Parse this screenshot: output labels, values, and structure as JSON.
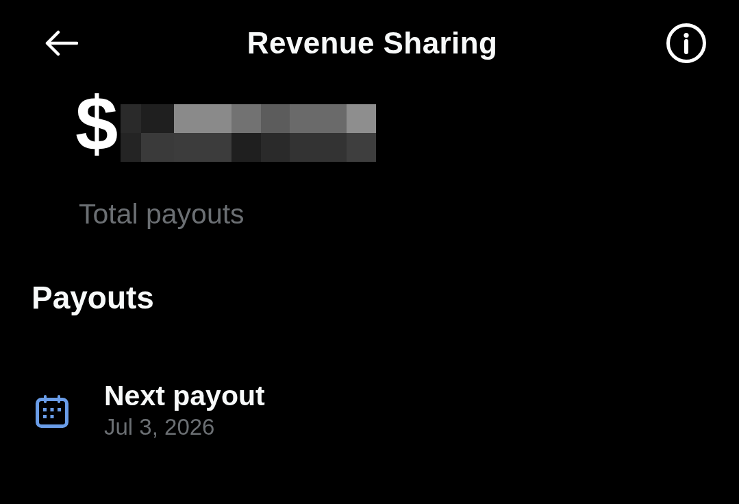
{
  "header": {
    "title": "Revenue Sharing"
  },
  "summary": {
    "amount_prefix": "$",
    "label": "Total payouts"
  },
  "payouts": {
    "heading": "Payouts",
    "items": [
      {
        "title": "Next payout",
        "date": "Jul 3, 2026"
      }
    ]
  }
}
